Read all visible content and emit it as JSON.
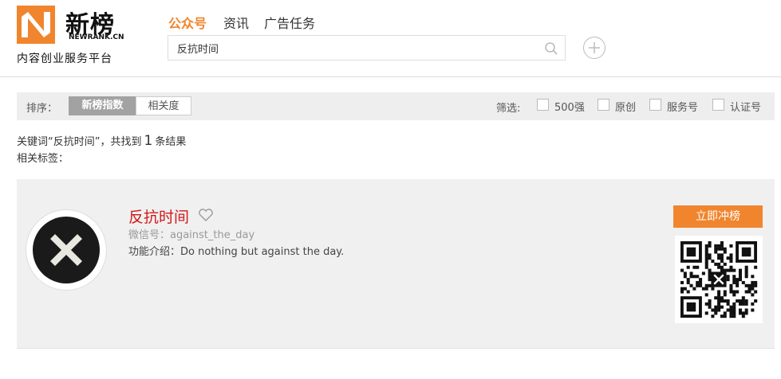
{
  "header": {
    "logo_cn": "新榜",
    "logo_en": "NEWRANK.CN",
    "tagline": "内容创业服务平台",
    "nav": [
      {
        "label": "公众号",
        "active": true
      },
      {
        "label": "资讯",
        "active": false
      },
      {
        "label": "广告任务",
        "active": false
      }
    ],
    "search_value": "反抗时间",
    "icons": {
      "search": "search-icon",
      "add": "plus-icon"
    },
    "accent_color": "#f0852d"
  },
  "sortbar": {
    "label": "排序：",
    "options": [
      {
        "label": "新榜指数",
        "active": true
      },
      {
        "label": "相关度",
        "active": false
      }
    ],
    "filter_label": "筛选:",
    "filters": [
      {
        "label": "500强",
        "checked": false
      },
      {
        "label": "原创",
        "checked": false
      },
      {
        "label": "服务号",
        "checked": false
      },
      {
        "label": "认证号",
        "checked": false
      }
    ]
  },
  "results": {
    "prefix": "关键词“反抗时间”，共找到",
    "count": "1",
    "suffix": "条结果",
    "tags_label": "相关标签："
  },
  "account": {
    "name": "反抗时间",
    "wechat_id": "微信号：against_the_day",
    "intro": "功能介绍：Do nothing but against the day.",
    "rank_button": "立即冲榜",
    "name_color": "#d0191a",
    "icons": {
      "favorite": "heart-icon",
      "avatar": "x-mark-icon",
      "qr": "qr-code-icon"
    }
  }
}
